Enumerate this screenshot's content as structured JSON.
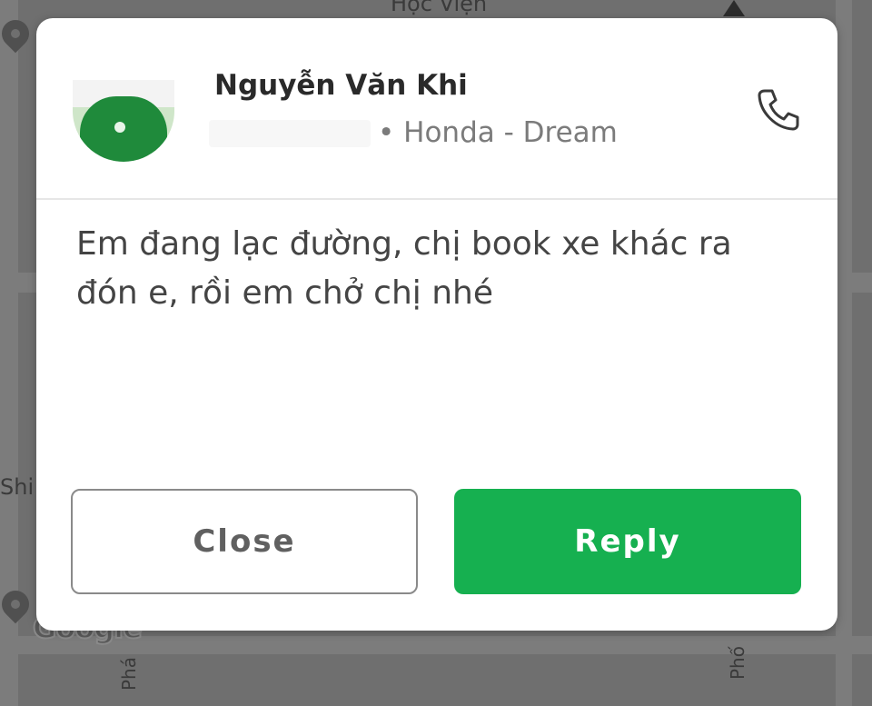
{
  "map": {
    "labels": {
      "top": "Học Viện",
      "left": "Shi",
      "bottom_left": "Phá",
      "bottom_right": "Phố"
    },
    "google_logo_text": "Google"
  },
  "dialog": {
    "driver": {
      "name": "Nguyễn Văn Khi",
      "vehicle": "• Honda - Dream"
    },
    "message": "Em đang lạc đường, chị book xe khác ra đón e, rồi em chở chị nhé",
    "buttons": {
      "close_label": "Close",
      "reply_label": "Reply"
    },
    "colors": {
      "accent": "#16b050",
      "text": "#444444",
      "secondary_text": "#7b7b7b"
    },
    "icons": {
      "call": "phone-icon",
      "avatar": "driver-avatar"
    }
  }
}
